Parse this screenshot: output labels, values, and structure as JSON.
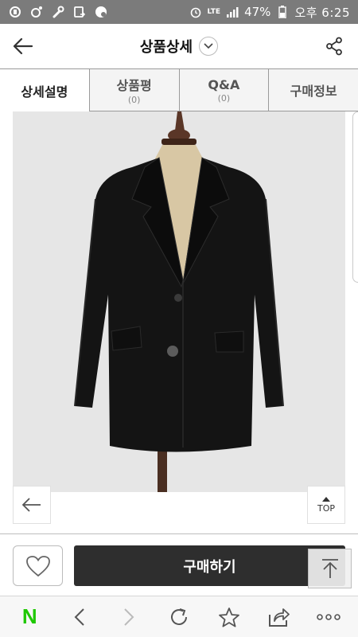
{
  "status_bar": {
    "network": "LTE",
    "battery": "47%",
    "time": "오후 6:25"
  },
  "header": {
    "title": "상품상세"
  },
  "tabs": [
    {
      "label": "상세설명",
      "count": ""
    },
    {
      "label": "상품평",
      "count": "(0)"
    },
    {
      "label": "Q&A",
      "count": "(0)"
    },
    {
      "label": "구매정보",
      "count": ""
    }
  ],
  "product": {
    "image_description_icon": "black-blazer-on-mannequin",
    "top_label": "TOP"
  },
  "buy_bar": {
    "buy_label": "구매하기"
  },
  "browser_bar": {
    "logo": "N",
    "icons": [
      "naver-logo",
      "back-icon",
      "forward-icon",
      "refresh-icon",
      "star-icon",
      "share-icon",
      "more-icon"
    ]
  },
  "colors": {
    "buy_button": "#2e2e2e",
    "status_bar": "#7b7b7b",
    "naver_green": "#1ec800",
    "product_bg": "#e6e6e6"
  }
}
